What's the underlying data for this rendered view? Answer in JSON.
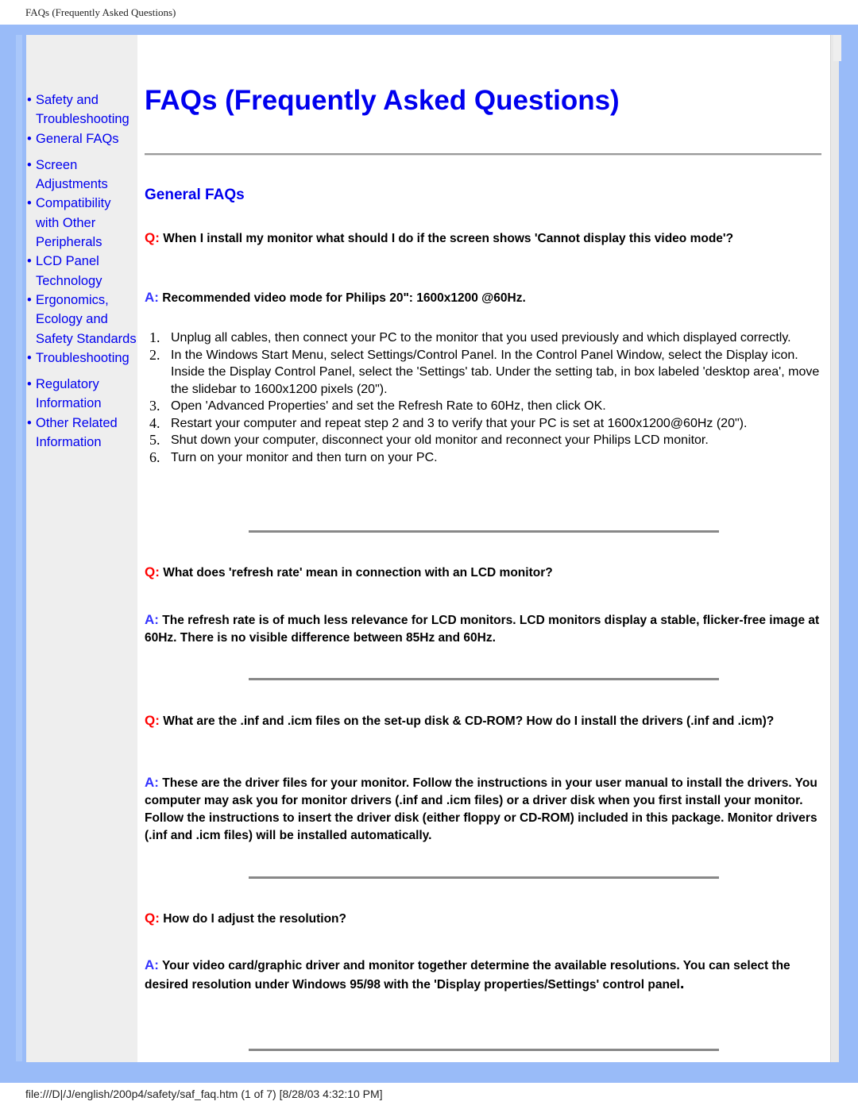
{
  "print_header": "FAQs (Frequently Asked Questions)",
  "print_footer": "file:///D|/J/english/200p4/safety/saf_faq.htm (1 of 7) [8/28/03 4:32:10 PM]",
  "sidebar": {
    "bullet": "•",
    "groups": [
      {
        "items": [
          {
            "label": "Safety and Troubleshooting"
          },
          {
            "label": "General FAQs"
          }
        ]
      },
      {
        "items": [
          {
            "label": "Screen Adjustments"
          },
          {
            "label": "Compatibility with Other Peripherals"
          },
          {
            "label": "LCD Panel Technology"
          },
          {
            "label": "Ergonomics, Ecology and Safety Standards"
          },
          {
            "label": "Troubleshooting"
          }
        ]
      },
      {
        "items": [
          {
            "label": "Regulatory Information"
          },
          {
            "label": "Other Related Information"
          }
        ]
      }
    ]
  },
  "main": {
    "title": "FAQs (Frequently Asked Questions)",
    "section_title": "General FAQs",
    "q_label": "Q:",
    "a_label": "A:",
    "faqs": [
      {
        "question": "When I install my monitor what should I do if the screen shows 'Cannot display this video mode'?",
        "answer": "Recommended video mode for Philips 20\": 1600x1200 @60Hz.",
        "steps": [
          {
            "num": "1.",
            "text": "Unplug all cables, then connect your PC to the monitor that you used previously and which displayed correctly."
          },
          {
            "num": "2.",
            "text": "In the Windows Start Menu, select Settings/Control Panel. In the Control Panel Window, select the Display icon. Inside the Display Control Panel, select the 'Settings' tab. Under the setting tab, in box labeled 'desktop area', move the slidebar to 1600x1200 pixels (20\")."
          },
          {
            "num": "3.",
            "text": "Open 'Advanced Properties' and set the Refresh Rate to 60Hz, then click OK."
          },
          {
            "num": "4.",
            "text": "Restart your computer and repeat step 2 and 3 to verify that your PC is set at 1600x1200@60Hz (20\")."
          },
          {
            "num": "5.",
            "text": "Shut down your computer, disconnect your old monitor and reconnect your Philips LCD monitor."
          },
          {
            "num": "6.",
            "text": "Turn on your monitor and then turn on your PC."
          }
        ]
      },
      {
        "question": "What does 'refresh rate' mean in connection with an LCD monitor?",
        "answer": "The refresh rate is of much less relevance for LCD monitors. LCD monitors display a stable, flicker-free image at 60Hz. There is no visible difference between 85Hz and 60Hz."
      },
      {
        "question": "What are the .inf and .icm files on the set-up disk & CD-ROM? How do I install the drivers (.inf and .icm)?",
        "answer": "These are the driver files for your monitor. Follow the instructions in your user manual to install the drivers. You computer may ask you for monitor drivers (.inf and .icm files) or a driver disk when you first install your monitor. Follow the instructions to insert the driver disk (either floppy or CD-ROM) included in this package. Monitor drivers (.inf and .icm files) will be installed automatically."
      },
      {
        "question": "How do I adjust the resolution?",
        "answer": "Your video card/graphic driver and monitor together determine the available resolutions. You can select the desired resolution under Windows 95/98 with the 'Display properties/Settings' control panel",
        "answer_end": "."
      }
    ]
  },
  "colors": {
    "frame": "#99bbf8",
    "sidebar_bg": "#eeeeee",
    "link": "#0000ee",
    "q_mark": "#ff0000",
    "a_mark": "#3333ff"
  }
}
